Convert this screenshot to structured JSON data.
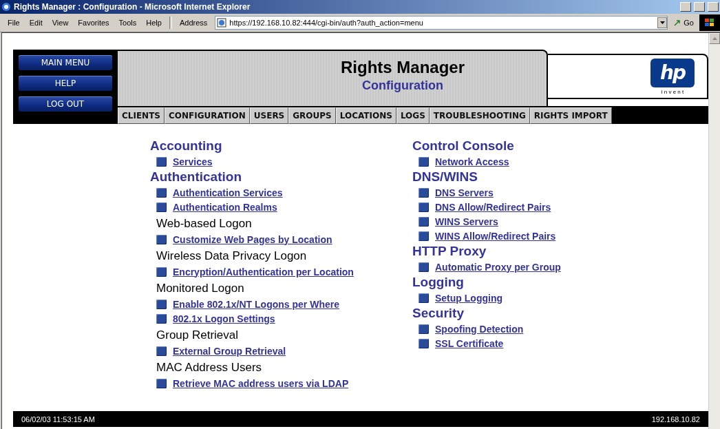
{
  "window": {
    "title": "Rights Manager : Configuration - Microsoft Internet Explorer"
  },
  "menu": [
    "File",
    "Edit",
    "View",
    "Favorites",
    "Tools",
    "Help"
  ],
  "address": {
    "label": "Address",
    "value": "https://192.168.10.82:444/cgi-bin/auth?auth_action=menu",
    "go": "Go"
  },
  "side_buttons": [
    "MAIN MENU",
    "HELP",
    "LOG OUT"
  ],
  "header": {
    "title": "Rights Manager",
    "subtitle": "Configuration"
  },
  "logo": {
    "mark": "hp",
    "tagline": "i n v e n t"
  },
  "tabs": [
    {
      "label": "CLIENTS",
      "selected": false
    },
    {
      "label": "CONFIGURATION",
      "selected": false
    },
    {
      "label": "USERS",
      "selected": false
    },
    {
      "label": "GROUPS",
      "selected": false
    },
    {
      "label": "LOCATIONS",
      "selected": false
    },
    {
      "label": "LOGS",
      "selected": false
    },
    {
      "label": "TROUBLESHOOTING",
      "selected": false
    },
    {
      "label": "RIGHTS IMPORT",
      "selected": false
    }
  ],
  "columns": [
    [
      {
        "kind": "heading",
        "text": "Accounting"
      },
      {
        "kind": "link",
        "text": "Services"
      },
      {
        "kind": "heading",
        "text": "Authentication"
      },
      {
        "kind": "link",
        "text": "Authentication Services"
      },
      {
        "kind": "link",
        "text": "Authentication Realms"
      },
      {
        "kind": "subheading",
        "text": "Web-based Logon"
      },
      {
        "kind": "link",
        "text": "Customize Web Pages by Location"
      },
      {
        "kind": "subheading",
        "text": "Wireless Data Privacy Logon"
      },
      {
        "kind": "link",
        "text": "Encryption/Authentication per Location"
      },
      {
        "kind": "subheading",
        "text": "Monitored Logon"
      },
      {
        "kind": "link",
        "text": "Enable 802.1x/NT Logons per Where"
      },
      {
        "kind": "link",
        "text": "802.1x Logon Settings"
      },
      {
        "kind": "subheading",
        "text": "Group Retrieval"
      },
      {
        "kind": "link",
        "text": "External Group Retrieval"
      },
      {
        "kind": "subheading",
        "text": "MAC Address Users"
      },
      {
        "kind": "link",
        "text": "Retrieve MAC address users via LDAP"
      }
    ],
    [
      {
        "kind": "heading",
        "text": "Control Console"
      },
      {
        "kind": "link",
        "text": "Network Access"
      },
      {
        "kind": "heading",
        "text": "DNS/WINS"
      },
      {
        "kind": "link",
        "text": "DNS Servers"
      },
      {
        "kind": "link",
        "text": "DNS Allow/Redirect Pairs"
      },
      {
        "kind": "link",
        "text": "WINS Servers"
      },
      {
        "kind": "link",
        "text": "WINS Allow/Redirect Pairs"
      },
      {
        "kind": "heading",
        "text": "HTTP Proxy"
      },
      {
        "kind": "link",
        "text": "Automatic Proxy per Group"
      },
      {
        "kind": "heading",
        "text": "Logging"
      },
      {
        "kind": "link",
        "text": "Setup Logging"
      },
      {
        "kind": "heading",
        "text": "Security"
      },
      {
        "kind": "link",
        "text": "Spoofing Detection"
      },
      {
        "kind": "link",
        "text": "SSL Certificate"
      }
    ]
  ],
  "footer": {
    "datetime": "06/02/03 11:53:15 AM",
    "ip": "192.168.10.82"
  }
}
